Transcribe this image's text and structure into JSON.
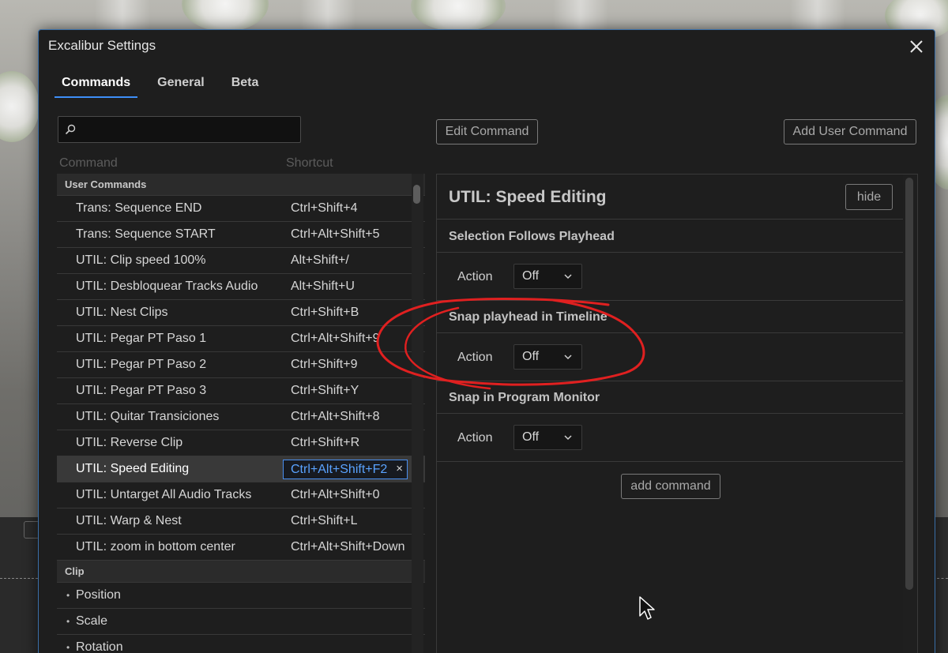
{
  "window": {
    "title": "Excalibur Settings"
  },
  "tabs": [
    {
      "label": "Commands",
      "active": true
    },
    {
      "label": "General",
      "active": false
    },
    {
      "label": "Beta",
      "active": false
    }
  ],
  "search": {
    "placeholder": "",
    "value": ""
  },
  "toolbar": {
    "edit_command_label": "Edit Command",
    "add_user_command_label": "Add User Command"
  },
  "columns": {
    "command": "Command",
    "shortcut": "Shortcut"
  },
  "groups": {
    "user_commands": "User Commands",
    "clip": "Clip"
  },
  "user_commands": [
    {
      "name": "Trans: Sequence END",
      "shortcut": "Ctrl+Shift+4"
    },
    {
      "name": "Trans: Sequence START",
      "shortcut": "Ctrl+Alt+Shift+5"
    },
    {
      "name": "UTIL: Clip speed 100%",
      "shortcut": "Alt+Shift+/"
    },
    {
      "name": "UTIL: Desbloquear Tracks Audio",
      "shortcut": "Alt+Shift+U"
    },
    {
      "name": "UTIL: Nest Clips",
      "shortcut": "Ctrl+Shift+B"
    },
    {
      "name": "UTIL: Pegar PT Paso 1",
      "shortcut": "Ctrl+Alt+Shift+9"
    },
    {
      "name": "UTIL: Pegar PT Paso 2",
      "shortcut": "Ctrl+Shift+9"
    },
    {
      "name": "UTIL: Pegar PT Paso 3",
      "shortcut": "Ctrl+Shift+Y"
    },
    {
      "name": "UTIL: Quitar Transiciones",
      "shortcut": "Ctrl+Alt+Shift+8"
    },
    {
      "name": "UTIL: Reverse Clip",
      "shortcut": "Ctrl+Shift+R"
    },
    {
      "name": "UTIL: Speed Editing",
      "shortcut": "Ctrl+Alt+Shift+F2",
      "selected": true
    },
    {
      "name": "UTIL: Untarget All Audio Tracks",
      "shortcut": "Ctrl+Alt+Shift+0"
    },
    {
      "name": "UTIL: Warp & Nest",
      "shortcut": "Ctrl+Shift+L"
    },
    {
      "name": "UTIL: zoom in bottom center",
      "shortcut": "Ctrl+Alt+Shift+Down"
    }
  ],
  "clip_commands": [
    {
      "name": "Position"
    },
    {
      "name": "Scale"
    },
    {
      "name": "Rotation"
    }
  ],
  "detail": {
    "title": "UTIL: Speed Editing",
    "hide_label": "hide",
    "action_label": "Action",
    "sections": [
      {
        "title": "Selection Follows Playhead",
        "action_value": "Off"
      },
      {
        "title": "Snap playhead in Timeline",
        "action_value": "Off"
      },
      {
        "title": "Snap in Program Monitor",
        "action_value": "Off"
      }
    ],
    "add_command_label": "add command"
  },
  "icons": {
    "search": "search-icon",
    "close": "close-icon",
    "clear_shortcut": "×",
    "dropdown": "chevron-down-icon",
    "cursor": "mouse-pointer-icon"
  },
  "colors": {
    "accent": "#3e8ef7",
    "dialog_bg": "#1e1e1e",
    "annotation": "#e02020"
  }
}
